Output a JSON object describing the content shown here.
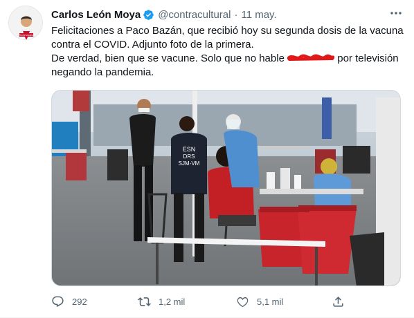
{
  "tweet": {
    "author": {
      "name": "Carlos León Moya",
      "handle": "@contracultural",
      "avatar_badge": "Yo me vacuno"
    },
    "date": "11 may.",
    "separator": "·",
    "lines": [
      "Felicitaciones a Paco Bazán, que recibió hoy su segunda dosis de la vacuna",
      "contra el COVID. Adjunto foto de la primera.",
      "De verdad, bien que se vacune. Solo que no hable",
      "por televisión",
      "negando la pandemia."
    ],
    "photo_labels": {
      "vest_line1": "ESN",
      "vest_line2": "DRS",
      "vest_line3": "SJM-VM"
    },
    "actions": {
      "replies": "292",
      "retweets": "1,2 mil",
      "likes": "5,1 mil"
    },
    "icons": [
      "verified-badge-icon",
      "more-icon",
      "reply-icon",
      "retweet-icon",
      "like-icon",
      "share-icon"
    ],
    "colors": {
      "verified": "#1d9bf0",
      "scribble": "#e0191b",
      "muted": "#536471"
    }
  }
}
